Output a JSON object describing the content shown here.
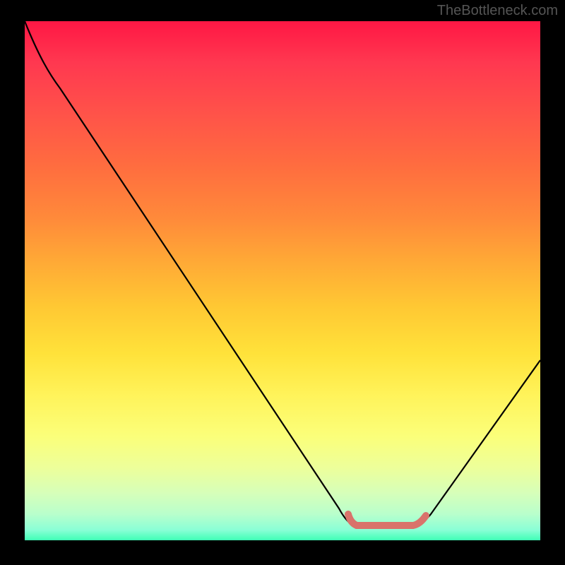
{
  "watermark": "TheBottleneck.com",
  "chart_data": {
    "type": "line",
    "title": "",
    "xlabel": "",
    "ylabel": "",
    "xlim": [
      0,
      100
    ],
    "ylim": [
      0,
      100
    ],
    "series": [
      {
        "name": "bottleneck-curve",
        "x": [
          0,
          5,
          10,
          20,
          30,
          40,
          50,
          60,
          63,
          70,
          76,
          80,
          90,
          100
        ],
        "y": [
          100,
          94,
          89,
          76,
          62,
          48,
          34,
          20,
          12,
          2,
          2,
          4,
          18,
          34
        ],
        "color": "#000000"
      }
    ],
    "highlight_region": {
      "x_start": 63,
      "x_end": 78,
      "color": "#d9736b",
      "description": "optimal-zone-marker"
    },
    "gradient_stops": [
      {
        "pos": 0,
        "color": "#ff1744"
      },
      {
        "pos": 50,
        "color": "#ffc833"
      },
      {
        "pos": 80,
        "color": "#fbff7a"
      },
      {
        "pos": 100,
        "color": "#3fffb5"
      }
    ]
  }
}
